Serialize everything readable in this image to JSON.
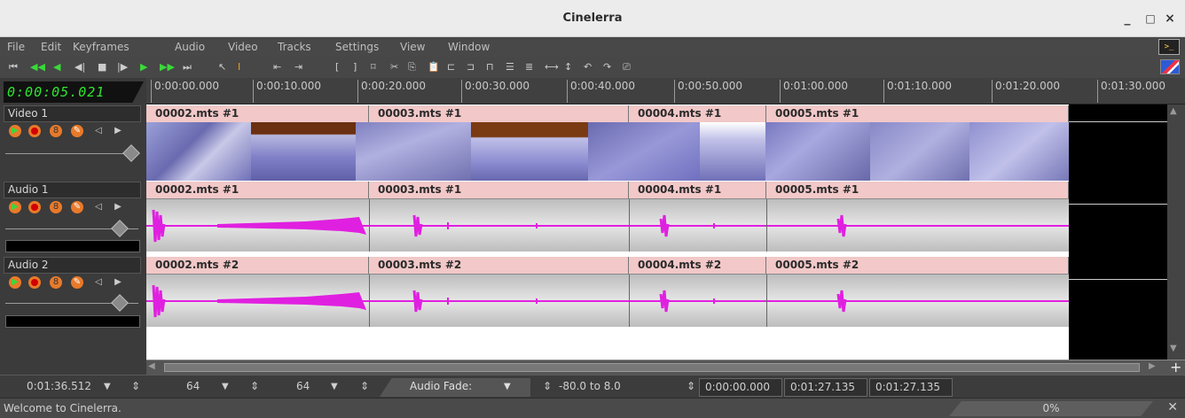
{
  "window": {
    "title": "Cinelerra",
    "minimize": "_",
    "maximize": "□",
    "close": "×"
  },
  "menu": [
    "File",
    "Edit",
    "Keyframes",
    "Audio",
    "Video",
    "Tracks",
    "Settings",
    "View",
    "Window"
  ],
  "clock": "0:00:05.021",
  "ruler": [
    "0:00:00.000",
    "0:00:10.000",
    "0:00:20.000",
    "0:00:30.000",
    "0:00:40.000",
    "0:00:50.000",
    "0:01:00.000",
    "0:01:10.000",
    "0:01:20.000",
    "0:01:30.000"
  ],
  "tracks": [
    {
      "name": "Video 1",
      "type": "video",
      "edits": [
        "00002.mts #1",
        "00003.mts #1",
        "00004.mts #1",
        "00005.mts #1"
      ]
    },
    {
      "name": "Audio 1",
      "type": "audio",
      "edits": [
        "00002.mts #1",
        "00003.mts #1",
        "00004.mts #1",
        "00005.mts #1"
      ]
    },
    {
      "name": "Audio 2",
      "type": "audio",
      "edits": [
        "00002.mts #2",
        "00003.mts #2",
        "00004.mts #2",
        "00005.mts #2"
      ]
    }
  ],
  "zoom": {
    "sample_zoom": "0:01:36.512",
    "amp_zoom": "64",
    "track_zoom": "64",
    "curve_mode": "Audio Fade:",
    "curve_range": "-80.0 to 8.0",
    "selection_start": "0:00:00.000",
    "selection_end": "0:01:27.135",
    "selection_length": "0:01:27.135"
  },
  "status": {
    "message": "Welcome to Cinelerra.",
    "progress": "0%"
  },
  "colors": {
    "clock": "#2ee62e",
    "waveform": "#e020e0",
    "edit_title_bg": "#f2c8c8",
    "transport_green": "#3ad83a"
  }
}
